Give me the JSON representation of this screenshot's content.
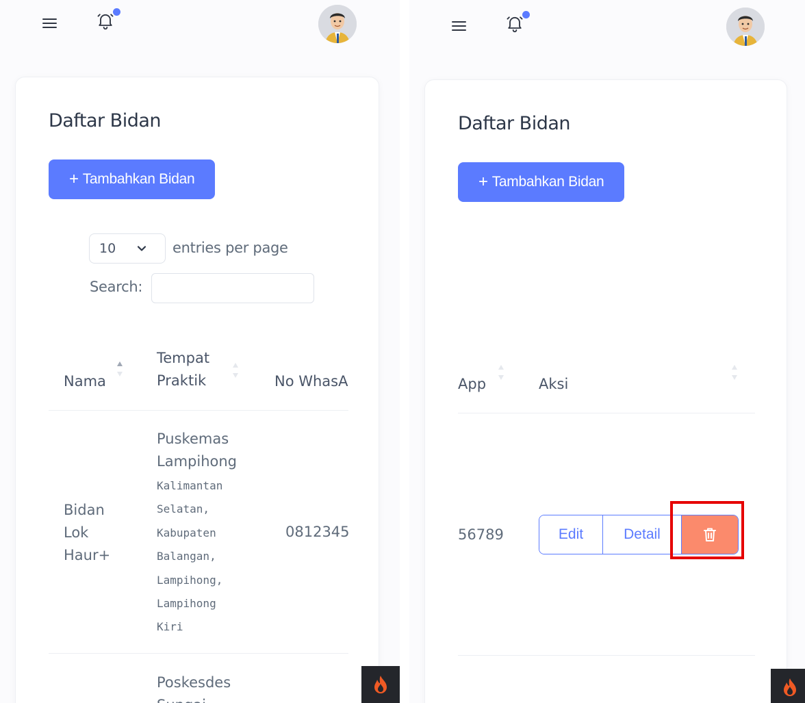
{
  "page": {
    "title": "Daftar Bidan",
    "add_button_label": "Tambahkan Bidan",
    "add_button_plus": "+",
    "accent_color": "#5b7bff",
    "danger_color": "#fb8a6c"
  },
  "left": {
    "entries": {
      "value": "10",
      "suffix": "entries per page"
    },
    "search": {
      "label": "Search:",
      "value": ""
    },
    "table": {
      "columns": [
        "Nama",
        "Tempat\nPraktik",
        "No WhasA"
      ],
      "rows": [
        {
          "nama_lines": [
            "Bidan",
            "Lok",
            "Haur+"
          ],
          "tempat_lines": [
            "Puskemas",
            "Lampihong"
          ],
          "alamat_lines": [
            "Kalimantan",
            "Selatan,",
            "Kabupaten",
            "Balangan,",
            "Lampihong,",
            "Lampihong",
            "Kiri"
          ],
          "no_whatsapp": "0812345"
        },
        {
          "tempat_lines": [
            "Poskesdes",
            "Sungai"
          ]
        }
      ]
    }
  },
  "right": {
    "table": {
      "columns": [
        "App",
        "Aksi"
      ],
      "rows": [
        {
          "app": "56789",
          "actions": {
            "edit": "Edit",
            "detail": "Detail",
            "delete_icon": "trash-icon"
          }
        }
      ]
    }
  }
}
